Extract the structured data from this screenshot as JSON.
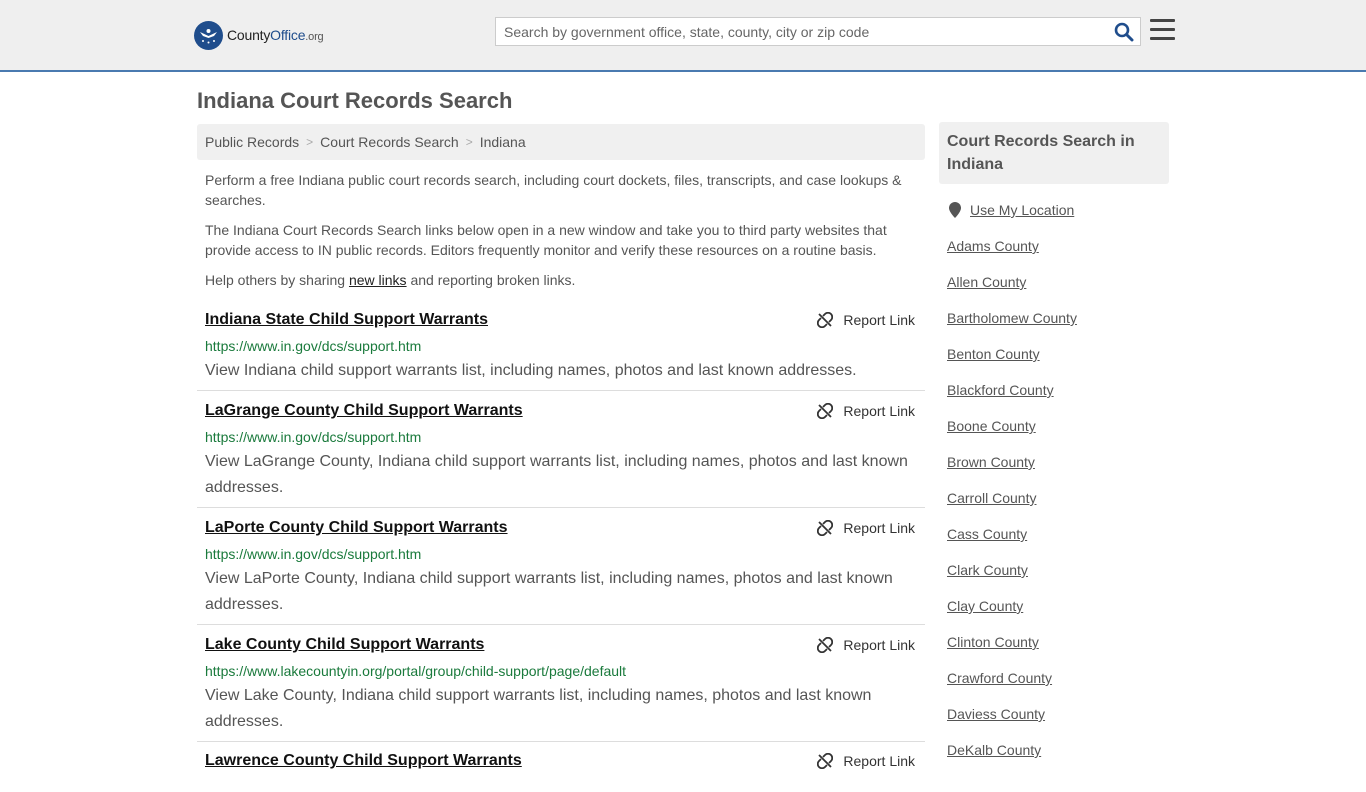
{
  "header": {
    "logo_main": "County",
    "logo_accent": "Office",
    "logo_suffix": ".org",
    "search_placeholder": "Search by government office, state, county, city or zip code"
  },
  "page_title": "Indiana Court Records Search",
  "breadcrumb": [
    "Public Records",
    "Court Records Search",
    "Indiana"
  ],
  "intro": {
    "p1": "Perform a free Indiana public court records search, including court dockets, files, transcripts, and case lookups & searches.",
    "p2": "The Indiana Court Records Search links below open in a new window and take you to third party websites that provide access to IN public records. Editors frequently monitor and verify these resources on a routine basis.",
    "p3_before": "Help others by sharing ",
    "p3_link": "new links",
    "p3_after": " and reporting broken links."
  },
  "report_label": "Report Link",
  "listings": [
    {
      "title": "Indiana State Child Support Warrants",
      "url": "https://www.in.gov/dcs/support.htm",
      "desc": "View Indiana child support warrants list, including names, photos and last known addresses."
    },
    {
      "title": "LaGrange County Child Support Warrants",
      "url": "https://www.in.gov/dcs/support.htm",
      "desc": "View LaGrange County, Indiana child support warrants list, including names, photos and last known addresses."
    },
    {
      "title": "LaPorte County Child Support Warrants",
      "url": "https://www.in.gov/dcs/support.htm",
      "desc": "View LaPorte County, Indiana child support warrants list, including names, photos and last known addresses."
    },
    {
      "title": "Lake County Child Support Warrants",
      "url": "https://www.lakecountyin.org/portal/group/child-support/page/default",
      "desc": "View Lake County, Indiana child support warrants list, including names, photos and last known addresses."
    },
    {
      "title": "Lawrence County Child Support Warrants",
      "url": "",
      "desc": ""
    }
  ],
  "sidebar": {
    "heading": "Court Records Search in Indiana",
    "location_label": "Use My Location",
    "counties": [
      "Adams County",
      "Allen County",
      "Bartholomew County",
      "Benton County",
      "Blackford County",
      "Boone County",
      "Brown County",
      "Carroll County",
      "Cass County",
      "Clark County",
      "Clay County",
      "Clinton County",
      "Crawford County",
      "Daviess County",
      "DeKalb County"
    ]
  }
}
